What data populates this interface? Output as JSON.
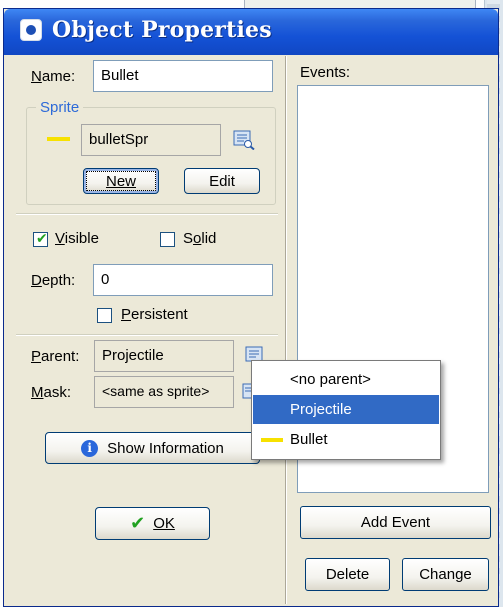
{
  "window": {
    "title": "Object Properties"
  },
  "name": {
    "label": "Name:",
    "value": "Bullet"
  },
  "sprite": {
    "group_label": "Sprite",
    "value": "bulletSpr",
    "new_label": "New",
    "edit_label": "Edit",
    "sprite_color": "#f7e100"
  },
  "visible": {
    "label": "Visible",
    "checked": true
  },
  "solid": {
    "label": "Solid",
    "checked": false
  },
  "depth": {
    "label": "Depth:",
    "value": "0"
  },
  "persistent": {
    "label": "Persistent",
    "checked": false
  },
  "parent": {
    "label": "Parent:",
    "value": "Projectile"
  },
  "mask": {
    "label": "Mask:",
    "value": "<same as sprite>"
  },
  "show_info": {
    "label": "Show Information"
  },
  "ok": {
    "label": "OK"
  },
  "events": {
    "label": "Events:",
    "add_label": "Add Event",
    "delete_label": "Delete",
    "change_label": "Change"
  },
  "parent_menu": {
    "items": [
      {
        "label": "<no parent>",
        "selected": false,
        "has_sprite": false
      },
      {
        "label": "Projectile",
        "selected": true,
        "has_sprite": false
      },
      {
        "label": "Bullet",
        "selected": false,
        "has_sprite": true
      }
    ]
  },
  "colors": {
    "titlebar": "#1452d6",
    "dialog_bg": "#ece9d8",
    "selection": "#316ac5",
    "check": "#21a121"
  }
}
